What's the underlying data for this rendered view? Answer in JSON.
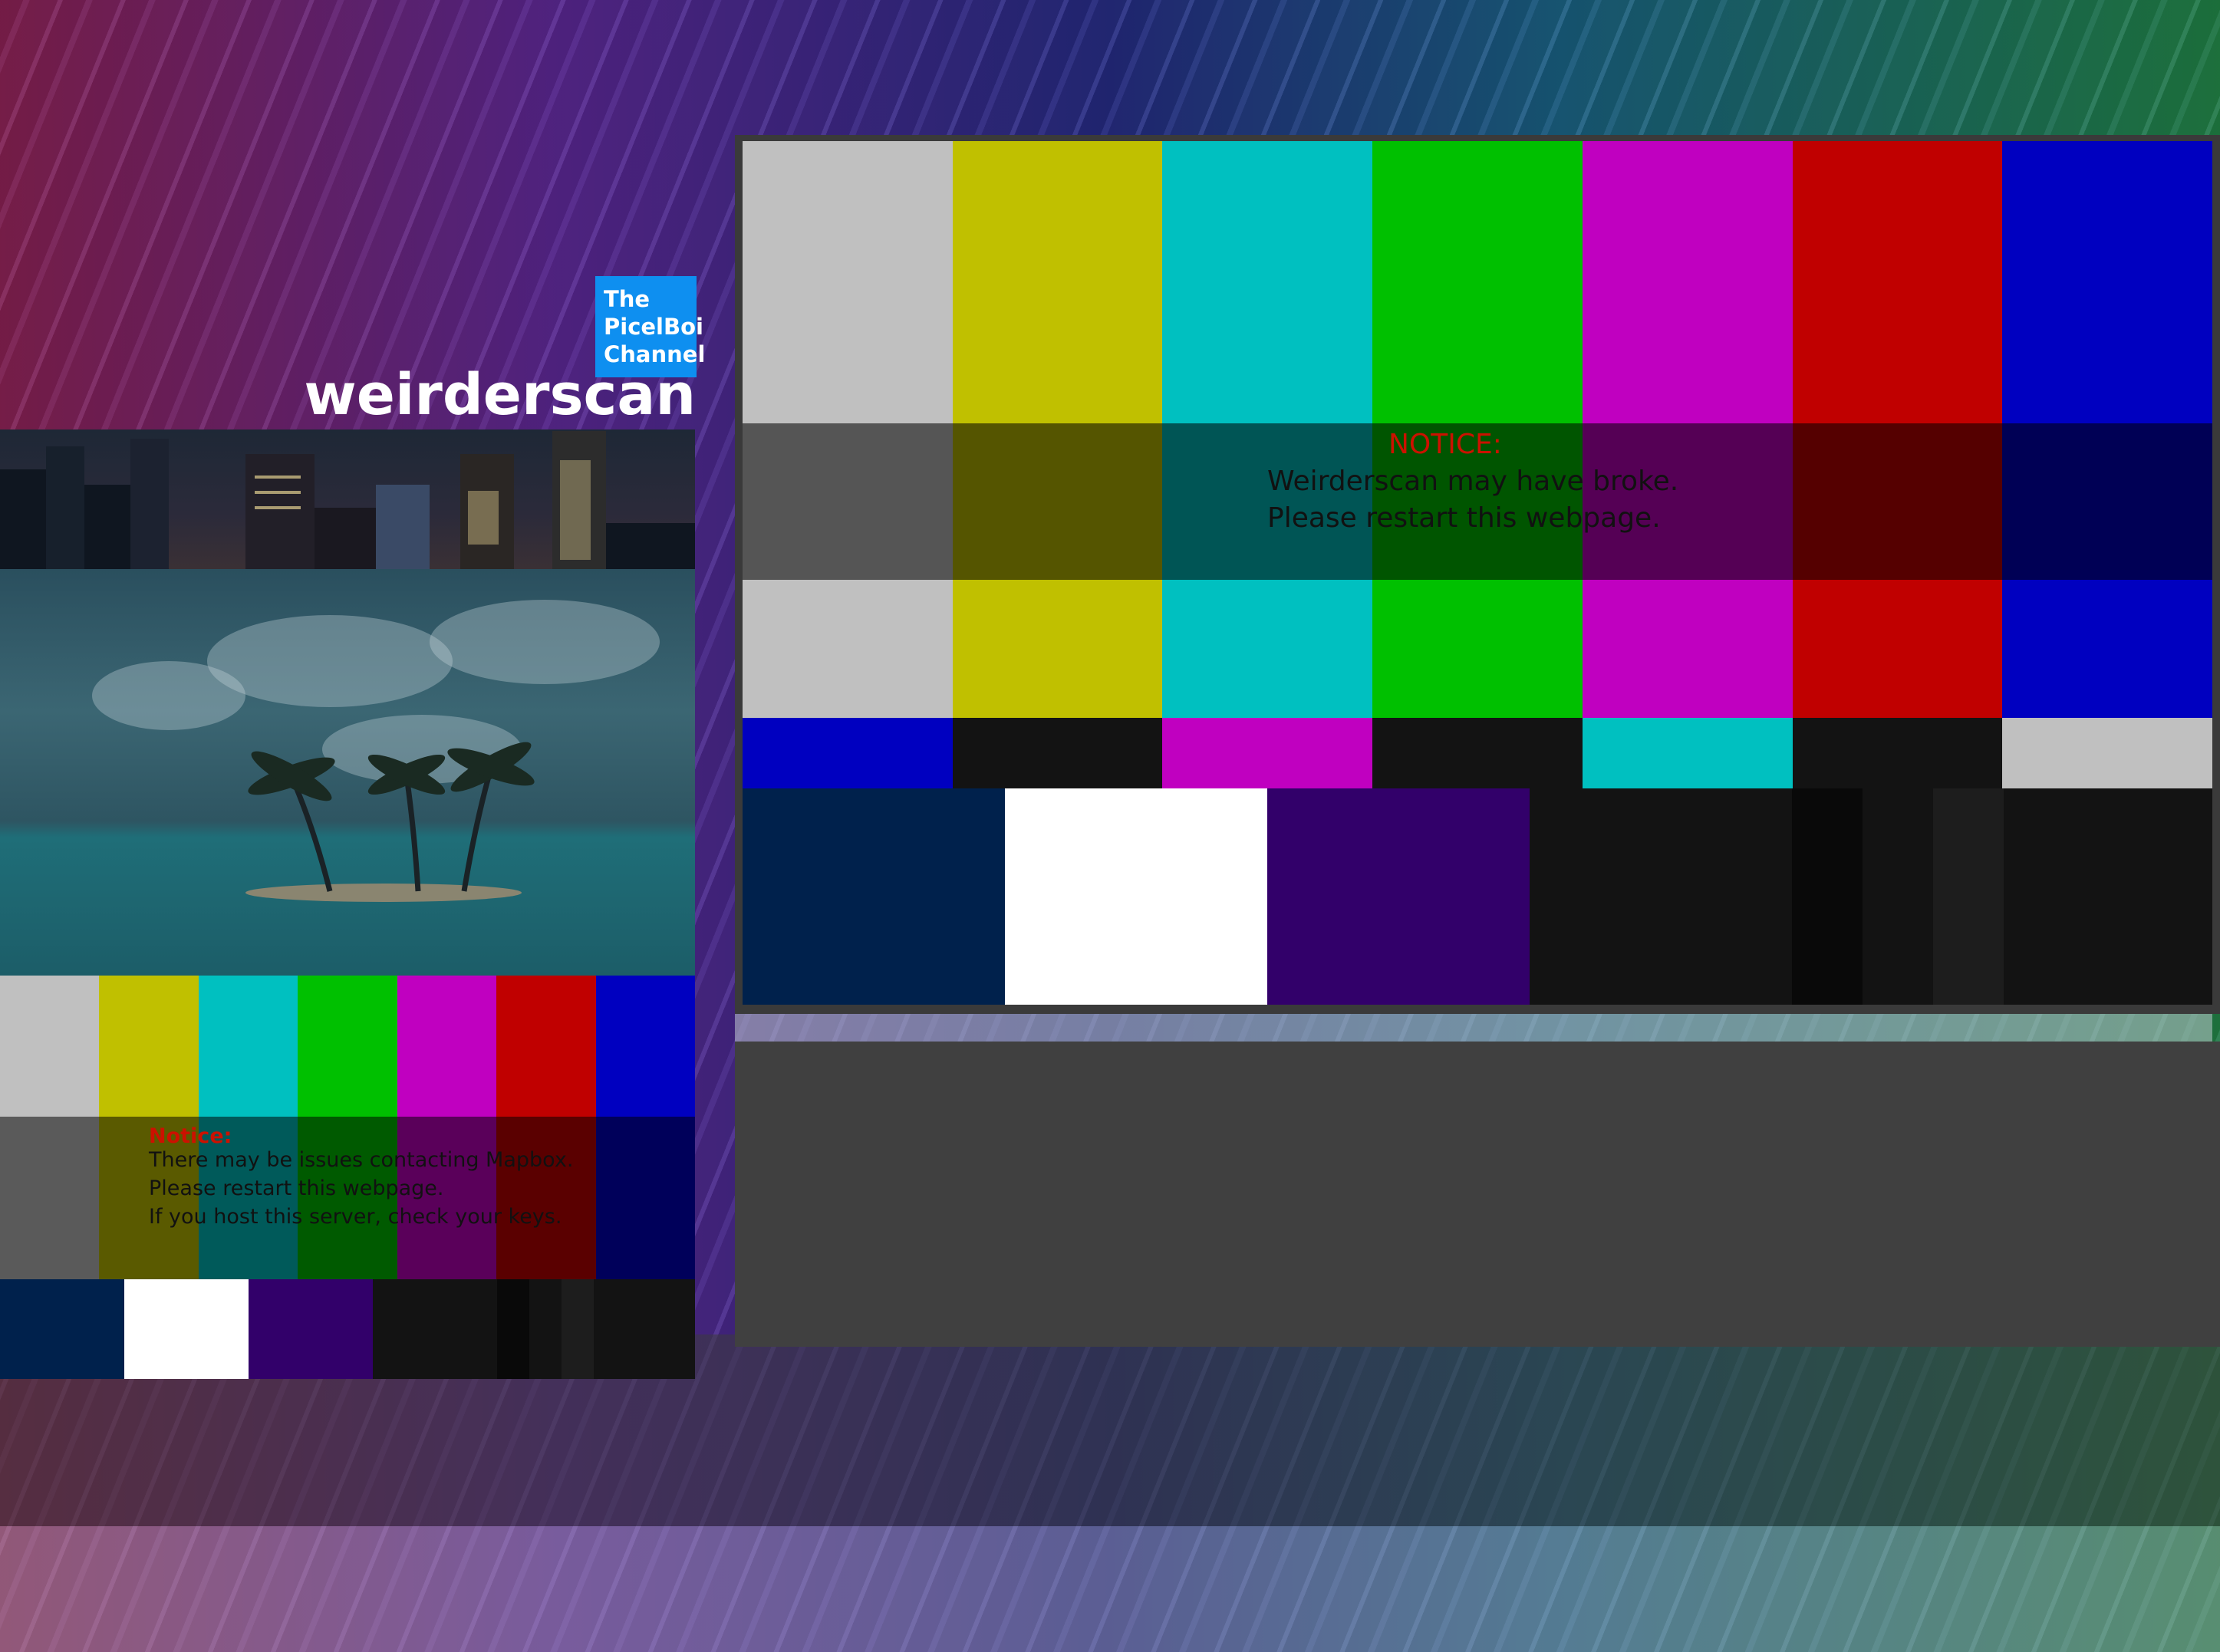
{
  "branding": {
    "logo_lines": [
      "The",
      "PicelBoi",
      "Channel"
    ],
    "title": "weirderscan"
  },
  "left_notice": {
    "heading": "Notice:",
    "lines": [
      "There may be issues contacting Mapbox.",
      "Please restart this webpage.",
      "If you host this server, check your keys."
    ]
  },
  "main_notice": {
    "heading": "NOTICE:",
    "lines": [
      "Weirderscan may have broke.",
      "Please restart this webpage."
    ]
  },
  "colors": {
    "bar_top": [
      "#c0c0c0",
      "#c0c000",
      "#00c0c0",
      "#00c000",
      "#c000c0",
      "#c00000",
      "#0000c0"
    ],
    "bar_mid": [
      "#0000c0",
      "#131313",
      "#c000c0",
      "#131313",
      "#00c0c0",
      "#131313",
      "#c0c0c0"
    ],
    "bar_bottom": [
      "#00214c",
      "#ffffff",
      "#32006a",
      "#131313",
      "#131313",
      "#090909",
      "#131313",
      "#1d1d1d",
      "#131313"
    ],
    "logo_blue": "#0e8ff0",
    "notice_red": "#cc1100",
    "panel_gray": "#404040"
  }
}
